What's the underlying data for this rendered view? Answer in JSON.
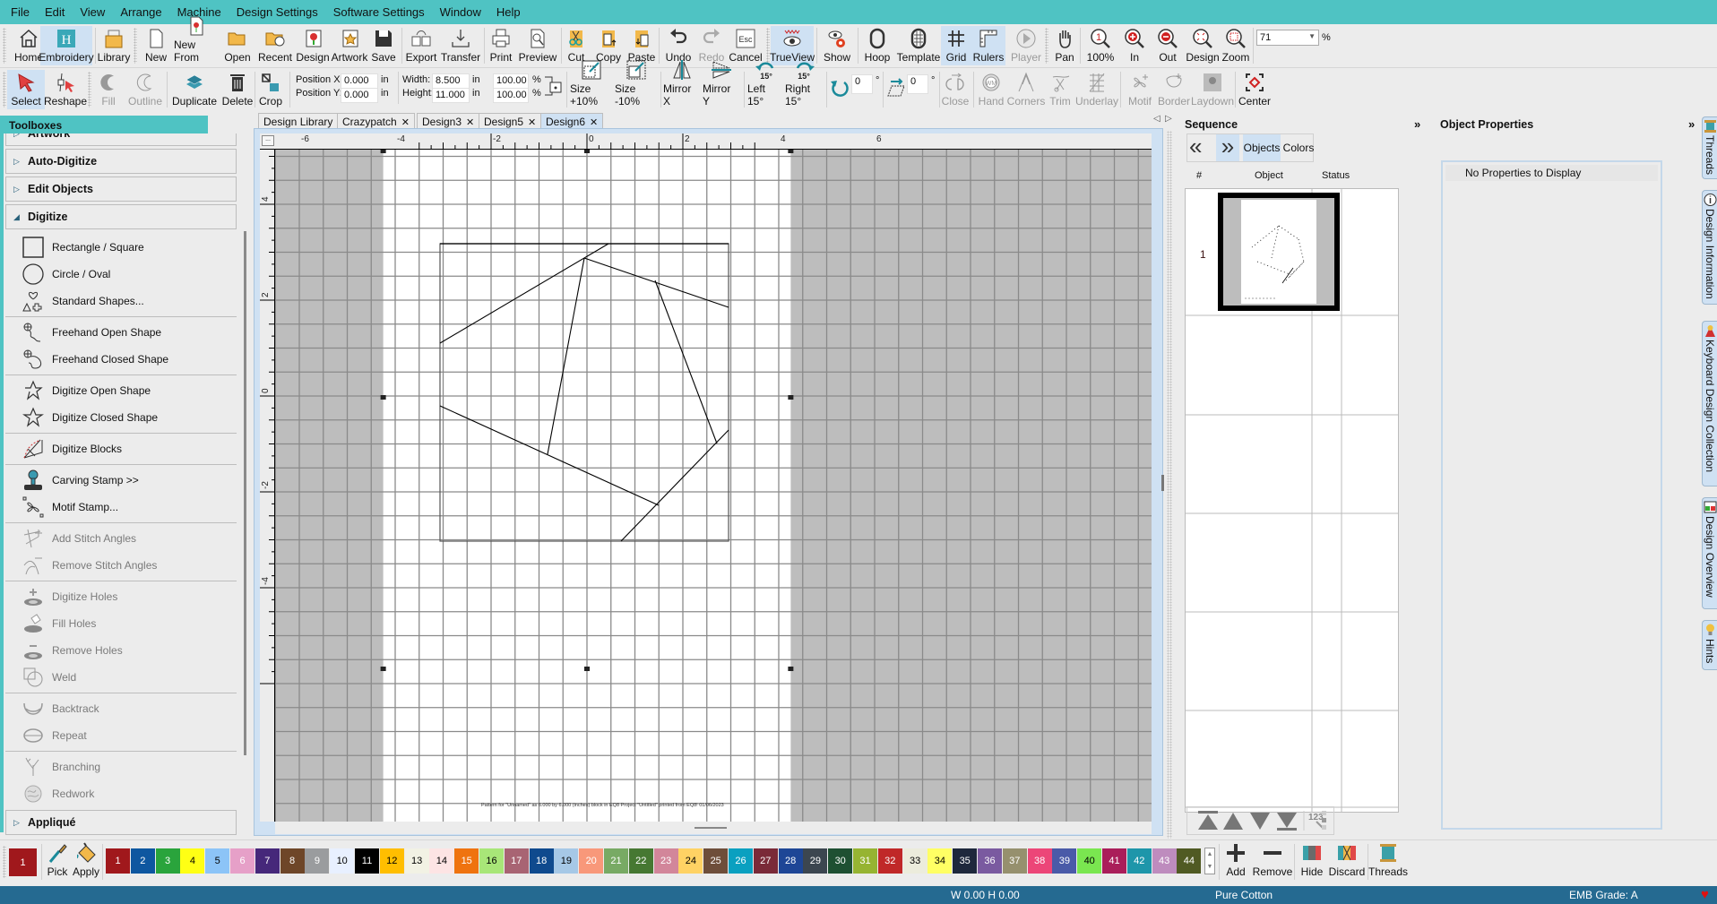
{
  "menu": [
    "File",
    "Edit",
    "View",
    "Arrange",
    "Machine",
    "Design Settings",
    "Software Settings",
    "Window",
    "Help"
  ],
  "toolbar1": {
    "home": "Home",
    "embroidery": "Embroidery",
    "library": "Library",
    "new": "New",
    "new_from": "New From",
    "open": "Open",
    "recent": "Recent",
    "design": "Design",
    "artwork": "Artwork",
    "save": "Save",
    "export": "Export",
    "transfer": "Transfer",
    "print": "Print",
    "preview": "Preview",
    "cut": "Cut",
    "copy": "Copy",
    "paste": "Paste",
    "undo": "Undo",
    "redo": "Redo",
    "cancel": "Cancel",
    "cancel_key": "Esc",
    "trueview": "TrueView",
    "show": "Show",
    "hoop": "Hoop",
    "template": "Template",
    "grid": "Grid",
    "rulers": "Rulers",
    "player": "Player",
    "pan": "Pan",
    "zoom100": "100%",
    "zoom_in": "In",
    "zoom_out": "Out",
    "zoom_design": "Design",
    "zoom_zoom": "Zoom",
    "zoom_value": "71",
    "zoom_unit": "%"
  },
  "toolbar2": {
    "select": "Select",
    "reshape": "Reshape",
    "fill": "Fill",
    "outline": "Outline",
    "duplicate": "Duplicate",
    "delete": "Delete",
    "crop": "Crop",
    "position_x_label": "Position X:",
    "position_x": "0.000",
    "position_y_label": "Position Y:",
    "position_y": "0.000",
    "unit": "in",
    "width_label": "Width:",
    "width": "8.500",
    "height_label": "Height:",
    "height": "11.000",
    "scale_w": "100.00",
    "scale_h": "100.00",
    "pct": "%",
    "size_plus": "Size +10%",
    "size_minus": "Size -10%",
    "mirror_x": "Mirror X",
    "mirror_y": "Mirror Y",
    "left15": "Left 15°",
    "right15": "Right 15°",
    "rot_glyph": "15°",
    "rotate_value": "0",
    "skew_value": "0",
    "deg": "°",
    "close": "Close",
    "hand": "Hand",
    "corners": "Corners",
    "trim": "Trim",
    "underlay": "Underlay",
    "motif": "Motif",
    "border": "Border",
    "laydown": "Laydown",
    "center": "Center"
  },
  "toolboxes": {
    "title": "Toolboxes",
    "sections": {
      "artwork": "Artwork",
      "auto_digitize": "Auto-Digitize",
      "edit_objects": "Edit Objects",
      "digitize": "Digitize",
      "applique": "Appliqué"
    },
    "items": [
      {
        "label": "Rectangle / Square",
        "enabled": true
      },
      {
        "label": "Circle / Oval",
        "enabled": true
      },
      {
        "label": "Standard Shapes...",
        "enabled": true
      },
      {
        "label": "Freehand Open Shape",
        "enabled": true
      },
      {
        "label": "Freehand Closed Shape",
        "enabled": true
      },
      {
        "label": "Digitize Open Shape",
        "enabled": true
      },
      {
        "label": "Digitize Closed Shape",
        "enabled": true
      },
      {
        "label": "Digitize Blocks",
        "enabled": true
      },
      {
        "label": "Carving Stamp >>",
        "enabled": true
      },
      {
        "label": "Motif Stamp...",
        "enabled": true
      },
      {
        "label": "Add Stitch Angles",
        "enabled": false
      },
      {
        "label": "Remove Stitch Angles",
        "enabled": false
      },
      {
        "label": "Digitize Holes",
        "enabled": false
      },
      {
        "label": "Fill Holes",
        "enabled": false
      },
      {
        "label": "Remove Holes",
        "enabled": false
      },
      {
        "label": "Weld",
        "enabled": false
      },
      {
        "label": "Backtrack",
        "enabled": false
      },
      {
        "label": "Repeat",
        "enabled": false
      },
      {
        "label": "Branching",
        "enabled": false
      },
      {
        "label": "Redwork",
        "enabled": false
      }
    ]
  },
  "doc_tabs": [
    {
      "label": "Design Library",
      "active": false
    },
    {
      "label": "Crazypatch",
      "active": false
    },
    {
      "label": "Design3",
      "active": false
    },
    {
      "label": "Design5",
      "active": false
    },
    {
      "label": "Design6",
      "active": true
    }
  ],
  "rulers": {
    "h_labels": [
      "-6",
      "-4",
      "-2",
      "0",
      "2",
      "4",
      "6"
    ],
    "v_labels": [
      "4",
      "2",
      "0",
      "-2",
      "-4"
    ]
  },
  "canvas": {
    "footer_text": "Pattern for \"Unnamed\" as 6.000 by 6.000 (inches) block in EQ8 Project \"Untitled\" printed from EQ8! 01/06/2023"
  },
  "sequence": {
    "title": "Sequence",
    "tab_objects": "Objects",
    "tab_colors": "Colors",
    "columns": [
      "#",
      "Object",
      "Status"
    ],
    "rows": [
      {
        "num": "1"
      }
    ]
  },
  "object_properties": {
    "title": "Object Properties",
    "empty_text": "No Properties to Display"
  },
  "side_tabs": [
    "Threads",
    "Design Information",
    "Keyboard Design Collection",
    "Design Overview",
    "Hints"
  ],
  "palette": {
    "current": {
      "num": "1",
      "color": "#a0181c"
    },
    "pick": "Pick",
    "apply": "Apply",
    "swatches": [
      {
        "n": "1",
        "c": "#a0181c",
        "t": "#fff"
      },
      {
        "n": "2",
        "c": "#0e57a0",
        "t": "#fff"
      },
      {
        "n": "3",
        "c": "#2aa43c",
        "t": "#fff"
      },
      {
        "n": "4",
        "c": "#ffff14",
        "t": "#000"
      },
      {
        "n": "5",
        "c": "#8cc4f7",
        "t": "#000"
      },
      {
        "n": "6",
        "c": "#e6a0c8",
        "t": "#fff"
      },
      {
        "n": "7",
        "c": "#46287a",
        "t": "#fff"
      },
      {
        "n": "8",
        "c": "#6e4628",
        "t": "#fff"
      },
      {
        "n": "9",
        "c": "#9a9c9e",
        "t": "#fff"
      },
      {
        "n": "10",
        "c": "#e8f0ff",
        "t": "#000"
      },
      {
        "n": "11",
        "c": "#000000",
        "t": "#fff"
      },
      {
        "n": "12",
        "c": "#ffbe00",
        "t": "#000"
      },
      {
        "n": "13",
        "c": "#f2f2e4",
        "t": "#000"
      },
      {
        "n": "14",
        "c": "#fde4e4",
        "t": "#000"
      },
      {
        "n": "15",
        "c": "#ef730f",
        "t": "#fff"
      },
      {
        "n": "16",
        "c": "#a8e678",
        "t": "#000"
      },
      {
        "n": "17",
        "c": "#a86473",
        "t": "#fff"
      },
      {
        "n": "18",
        "c": "#0f4a8e",
        "t": "#fff"
      },
      {
        "n": "19",
        "c": "#a6c8e6",
        "t": "#000"
      },
      {
        "n": "20",
        "c": "#f8987a",
        "t": "#fff"
      },
      {
        "n": "21",
        "c": "#78aa64",
        "t": "#fff"
      },
      {
        "n": "22",
        "c": "#467832",
        "t": "#fff"
      },
      {
        "n": "23",
        "c": "#d2869a",
        "t": "#fff"
      },
      {
        "n": "24",
        "c": "#ffd264",
        "t": "#000"
      },
      {
        "n": "25",
        "c": "#6e4e3a",
        "t": "#fff"
      },
      {
        "n": "26",
        "c": "#0aa0c0",
        "t": "#fff"
      },
      {
        "n": "27",
        "c": "#7a2a38",
        "t": "#fff"
      },
      {
        "n": "28",
        "c": "#1e4696",
        "t": "#fff"
      },
      {
        "n": "29",
        "c": "#3c4650",
        "t": "#fff"
      },
      {
        "n": "30",
        "c": "#1e5032",
        "t": "#fff"
      },
      {
        "n": "31",
        "c": "#96b432",
        "t": "#fff"
      },
      {
        "n": "32",
        "c": "#c02828",
        "t": "#fff"
      },
      {
        "n": "33",
        "c": "#ececdc",
        "t": "#000"
      },
      {
        "n": "34",
        "c": "#ffff64",
        "t": "#000"
      },
      {
        "n": "35",
        "c": "#1e283c",
        "t": "#fff"
      },
      {
        "n": "36",
        "c": "#7a5aa0",
        "t": "#fff"
      },
      {
        "n": "37",
        "c": "#96906e",
        "t": "#fff"
      },
      {
        "n": "38",
        "c": "#ec4678",
        "t": "#fff"
      },
      {
        "n": "39",
        "c": "#4a5aa8",
        "t": "#fff"
      },
      {
        "n": "40",
        "c": "#7ae650",
        "t": "#000"
      },
      {
        "n": "41",
        "c": "#aa1e5a",
        "t": "#fff"
      },
      {
        "n": "42",
        "c": "#1e96aa",
        "t": "#fff"
      },
      {
        "n": "43",
        "c": "#be8cbe",
        "t": "#fff"
      },
      {
        "n": "44",
        "c": "#505a23",
        "t": "#fff"
      }
    ],
    "add": "Add",
    "remove": "Remove",
    "hide": "Hide",
    "discard": "Discard",
    "threads": "Threads"
  },
  "status": {
    "dims": "W 0.00 H 0.00",
    "fabric": "Pure Cotton",
    "grade": "EMB Grade: A"
  },
  "colors": {
    "accent": "#4fc3c3",
    "status_bar": "#256a91",
    "selected": "#cfe1f3",
    "heart": "#e01010"
  }
}
